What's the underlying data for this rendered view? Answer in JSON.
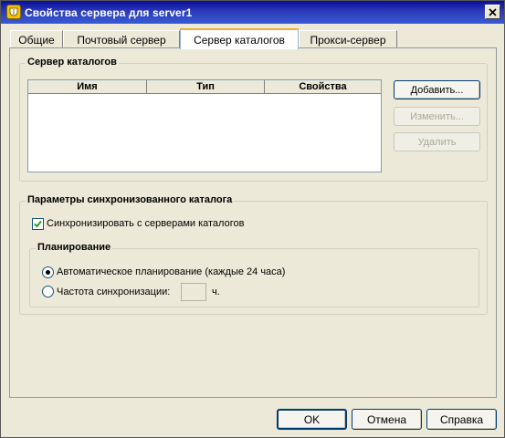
{
  "window": {
    "title": "Свойства сервера для server1"
  },
  "tabs": [
    {
      "label": "Общие"
    },
    {
      "label": "Почтовый сервер"
    },
    {
      "label": "Сервер каталогов"
    },
    {
      "label": "Прокси-сервер"
    }
  ],
  "directory_servers": {
    "group_title": "Сервер каталогов",
    "columns": [
      "Имя",
      "Тип",
      "Свойства"
    ],
    "rows": [],
    "buttons": {
      "add": "Добавить...",
      "edit": "Изменить...",
      "delete": "Удалить"
    }
  },
  "sync": {
    "group_title": "Параметры синхронизованного каталога",
    "checkbox_label": "Синхронизировать с серверами каталогов",
    "checkbox_checked": true,
    "schedule": {
      "group_title": "Планирование",
      "auto_label": "Автоматическое планирование (каждые 24 часа)",
      "freq_label": "Частота синхронизации:",
      "freq_value": "",
      "freq_unit": "ч.",
      "selected": "auto"
    }
  },
  "footer": {
    "ok": "OK",
    "cancel": "Отмена",
    "help": "Справка"
  }
}
